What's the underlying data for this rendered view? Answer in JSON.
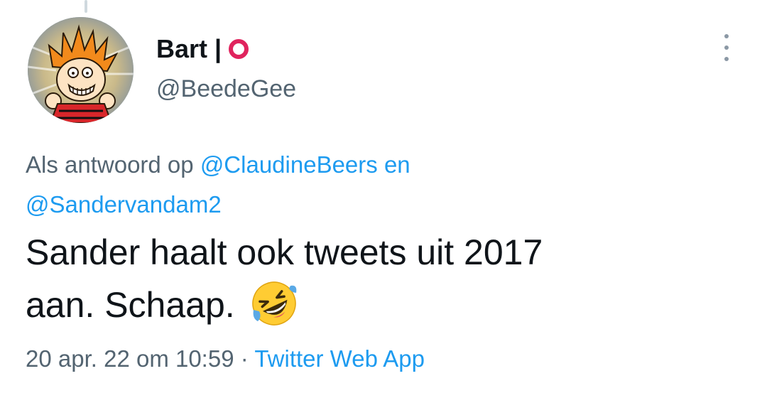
{
  "author": {
    "display_name": "Bart |",
    "handle": "@BeedeGee",
    "badge_color": "#e0245e"
  },
  "reply_context": {
    "prefix": "Als antwoord op",
    "mention_1": "@ClaudineBeers",
    "joiner": "en",
    "mention_2": "@Sandervandam2"
  },
  "tweet": {
    "line_1": "Sander haalt ook tweets uit 2017",
    "line_2": "aan. Schaap.",
    "emoji": "rolling-on-floor-laughing"
  },
  "meta": {
    "timestamp": "20 apr. 22 om 10:59",
    "separator": "·",
    "source": "Twitter Web App"
  },
  "icons": {
    "more": "more-options-icon",
    "avatar": "calvin-cartoon-avatar"
  },
  "colors": {
    "link": "#1d9bf0",
    "secondary_text": "#536471",
    "primary_text": "#0f1419"
  }
}
